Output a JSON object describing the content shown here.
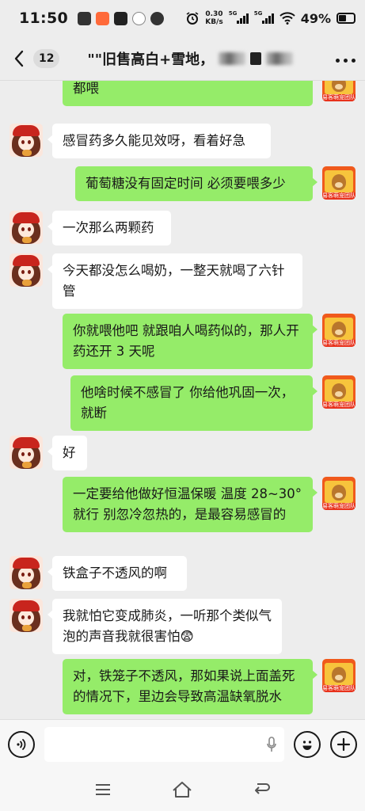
{
  "status_bar": {
    "time": "11:50",
    "net_speed_value": "0.30",
    "net_speed_unit": "KB/s",
    "sim1_label": "5G",
    "sim2_label": "5G",
    "battery_percent": "49%",
    "battery_level": 0.49
  },
  "header": {
    "unread_count": "12",
    "title": "\"\"旧售高白+雪地，",
    "more_icon": "more-icon",
    "back_icon": "chevron-left-icon"
  },
  "messages": [
    {
      "side": "right",
      "avatar": "shop",
      "text": "喂就喂它点儿，不用说跟药一样，每次都喂"
    },
    {
      "side": "left",
      "avatar": "girl",
      "text": "感冒药多久能见效呀，看着好急"
    },
    {
      "side": "right",
      "avatar": "shop",
      "text": "葡萄糖没有固定时间 必须要喂多少"
    },
    {
      "side": "left",
      "avatar": "girl",
      "text": "一次那么两颗药"
    },
    {
      "side": "left",
      "avatar": "girl",
      "text": "今天都没怎么喝奶，一整天就喝了六针管"
    },
    {
      "side": "right",
      "avatar": "shop",
      "text": "你就喂他吧 就跟咱人喝药似的，那人开药还开 3 天呢"
    },
    {
      "side": "right",
      "avatar": "shop",
      "text": "他啥时候不感冒了 你给他巩固一次，就断"
    },
    {
      "side": "left",
      "avatar": "girl",
      "text": "好"
    },
    {
      "side": "right",
      "avatar": "shop",
      "text": "一定要给他做好恒温保暖 温度 28~30° 就行  别忽冷忽热的，是最容易感冒的"
    },
    {
      "side": "left",
      "avatar": "girl",
      "text": "铁盒子不透风的啊"
    },
    {
      "side": "left",
      "avatar": "girl",
      "text": "我就怕它变成肺炎，一听那个类似气泡的声音我就很害怕😨"
    },
    {
      "side": "right",
      "avatar": "shop",
      "text": "对，铁笼子不透风，那如果说上面盖死的情况下，里边会导致高温缺氧脱水"
    }
  ],
  "avatars": {
    "shop_caption": "易客萌宠团队"
  },
  "input_bar": {
    "voice_icon": "voice-icon",
    "mic_icon": "mic-icon",
    "emoji_icon": "emoji-icon",
    "add_icon": "add-icon"
  },
  "nav_bar": {
    "menu_icon": "menu-icon",
    "home_icon": "home-icon",
    "back_icon": "back-icon"
  }
}
